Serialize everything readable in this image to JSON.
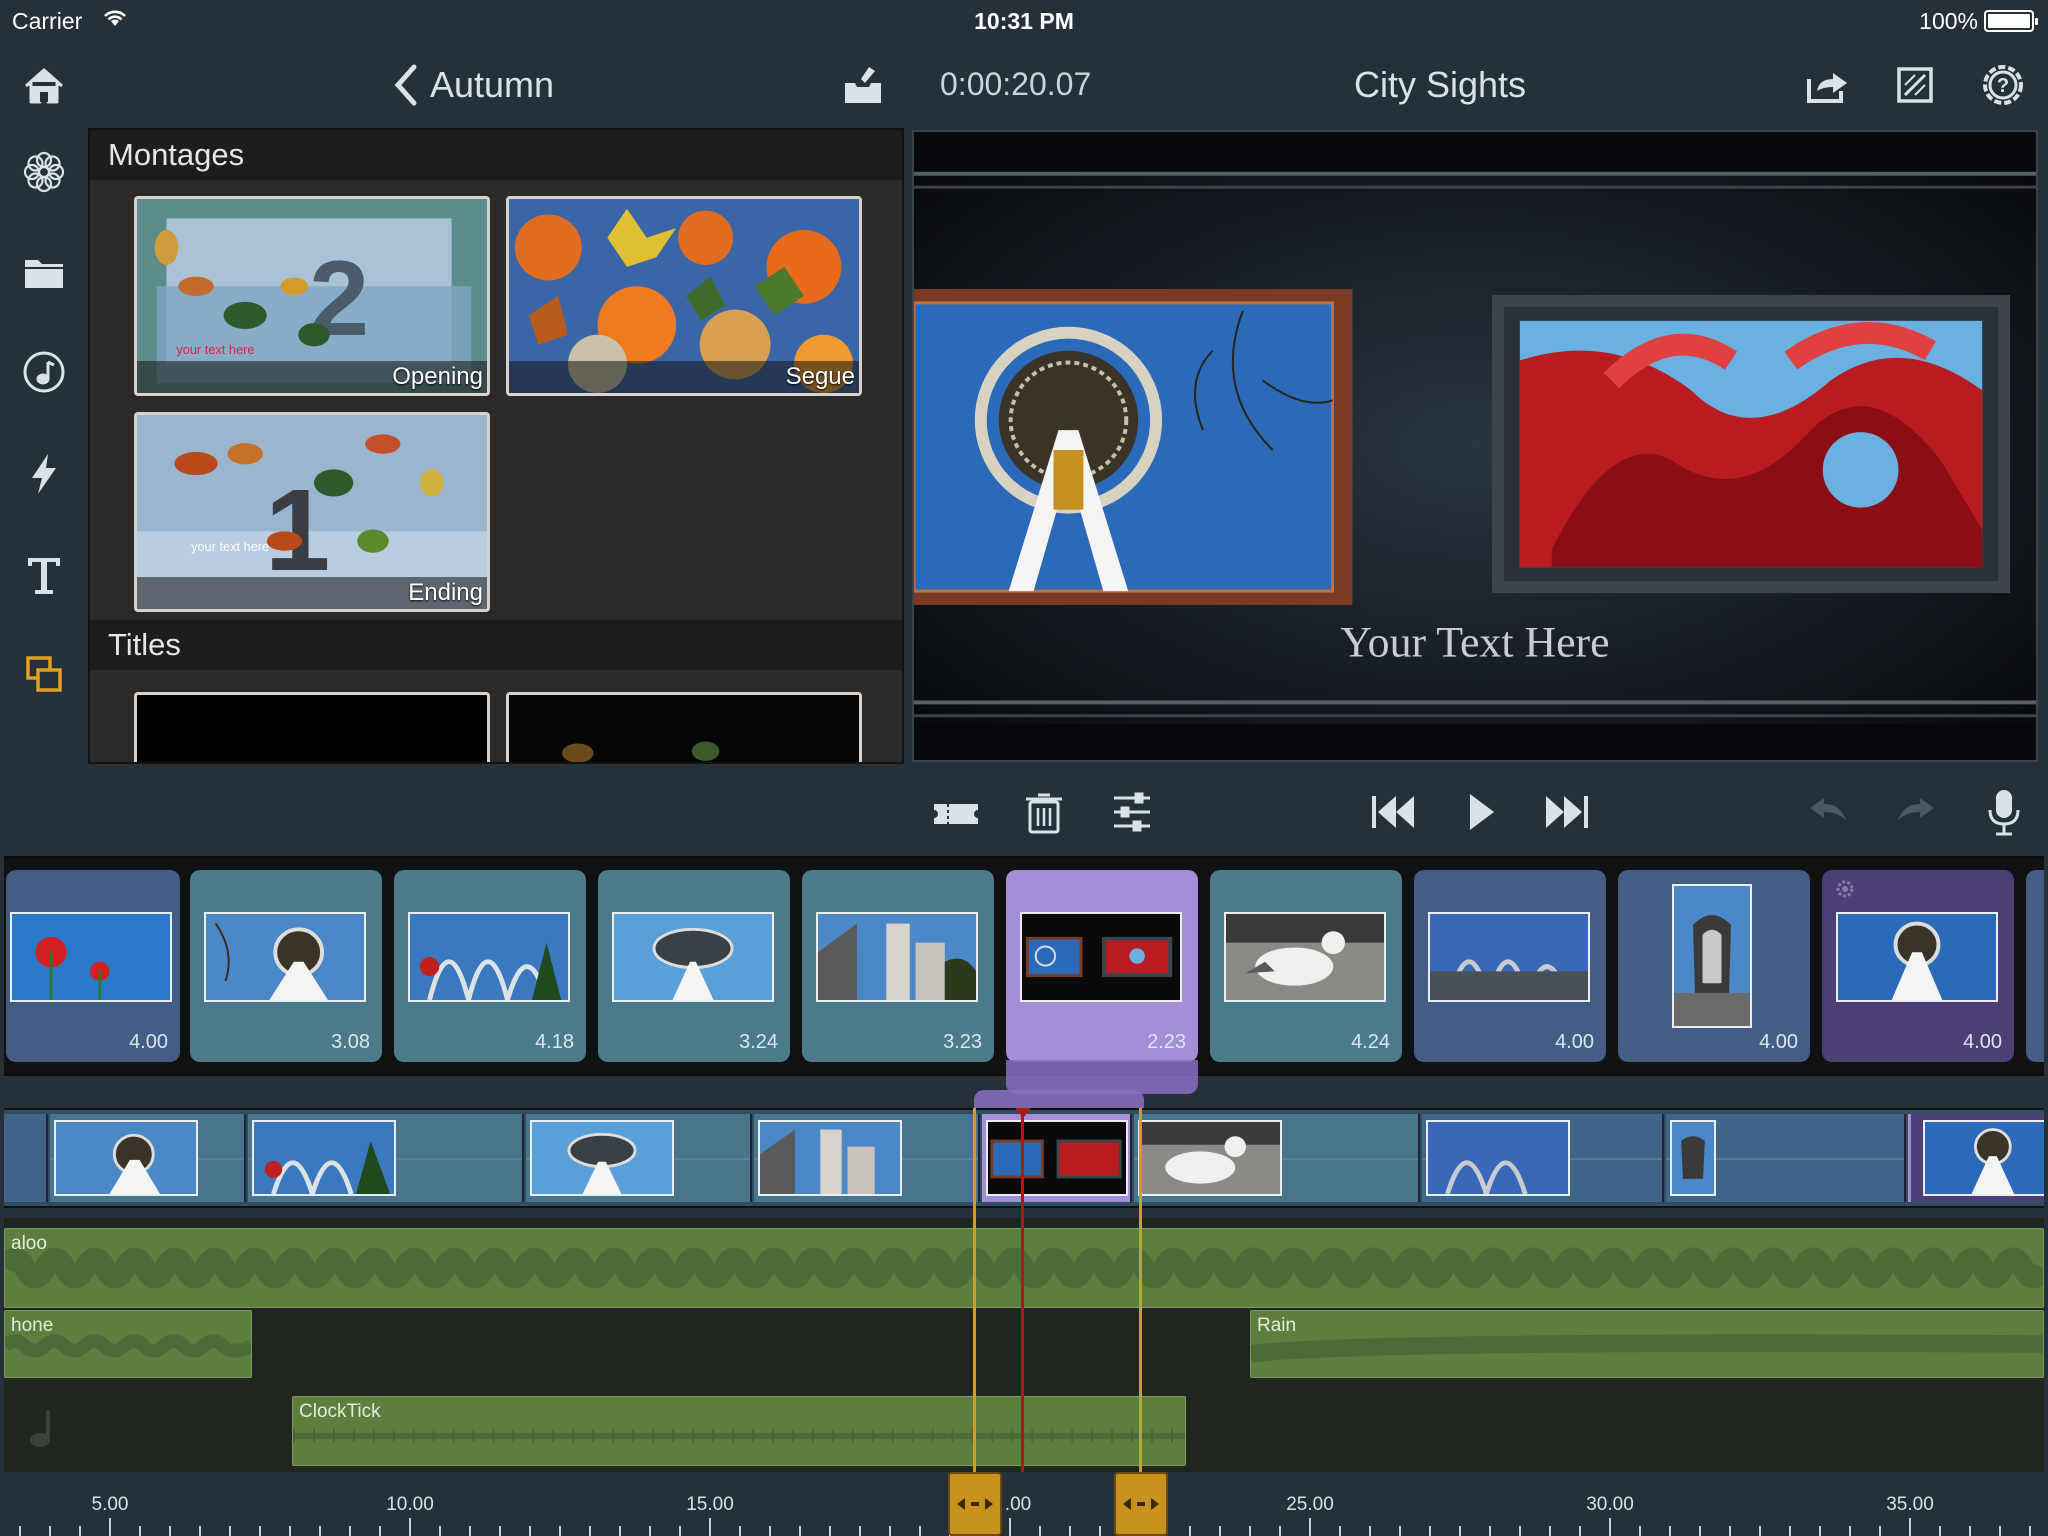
{
  "status_bar": {
    "carrier": "Carrier",
    "time": "10:31 PM",
    "battery": "100%"
  },
  "header": {
    "back_label": "Autumn",
    "timecode": "0:00:20.07",
    "project_title": "City Sights"
  },
  "library": {
    "sections": [
      {
        "title": "Montages",
        "items": [
          "Opening",
          "Segue",
          "Ending"
        ]
      },
      {
        "title": "Titles",
        "items": []
      }
    ],
    "thumbnail_text": {
      "opening": "your text here",
      "ending": "your text here"
    }
  },
  "preview": {
    "overlay_text": "Your Text Here"
  },
  "sidebar_icons": [
    "home-icon",
    "flower-icon",
    "folder-icon",
    "music-icon",
    "lightning-icon",
    "text-icon",
    "layers-icon"
  ],
  "toolbar_icons": [
    "ticket-icon",
    "trash-icon",
    "sliders-icon",
    "skip-back-icon",
    "play-icon",
    "skip-forward-icon",
    "undo-icon",
    "redo-icon",
    "microphone-icon"
  ],
  "clips": [
    {
      "duration": "4.00"
    },
    {
      "duration": "3.08"
    },
    {
      "duration": "4.18"
    },
    {
      "duration": "3.24"
    },
    {
      "duration": "3.23"
    },
    {
      "duration": "2.23"
    },
    {
      "duration": "4.24"
    },
    {
      "duration": "4.00"
    },
    {
      "duration": "4.00"
    },
    {
      "duration": "4.00"
    }
  ],
  "audio_tracks": [
    "aloo",
    "hone",
    "Rain",
    "ClockTick"
  ],
  "ruler": {
    "labels": [
      "5.00",
      "10.00",
      "15.00",
      ".00",
      "25.00",
      "30.00",
      "35.00"
    ]
  },
  "colors": {
    "background": "#253038",
    "selected_clip": "#a48ed8",
    "audio": "#5d7e3e",
    "playhead": "#b01818",
    "trim": "#c9921f",
    "accent_icon": "#e0a020"
  }
}
